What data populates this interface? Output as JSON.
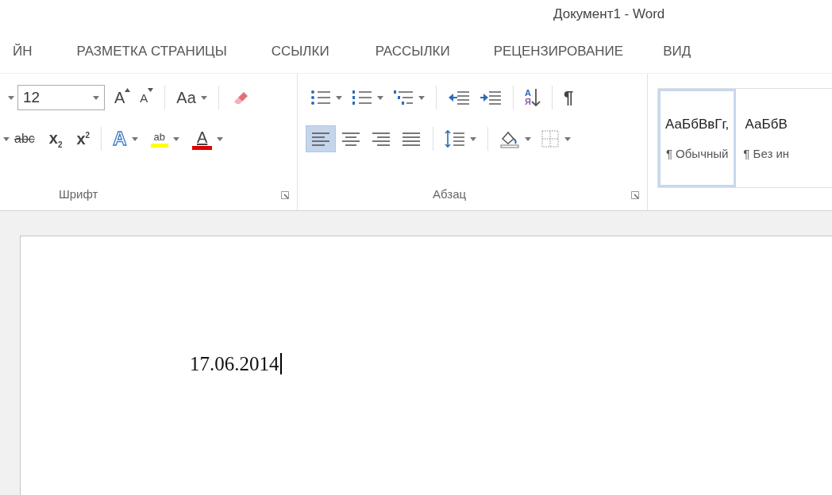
{
  "window": {
    "title": "Документ1 - Word"
  },
  "tabs": [
    {
      "label": "ЙН",
      "selected": false
    },
    {
      "label": "РАЗМЕТКА СТРАНИЦЫ",
      "selected": false
    },
    {
      "label": "ССЫЛКИ",
      "selected": false
    },
    {
      "label": "РАССЫЛКИ",
      "selected": false
    },
    {
      "label": "РЕЦЕНЗИРОВАНИЕ",
      "selected": false
    },
    {
      "label": "ВИД",
      "selected": false
    }
  ],
  "font_group": {
    "font_size": "12",
    "grow_font": "A",
    "shrink_font": "A",
    "change_case": "Aa",
    "strikethrough": "abc",
    "subscript": "x$_{2}$",
    "superscript": "x$^{2}$",
    "text_effects": "A",
    "highlight": "ab",
    "font_color": "A",
    "label": "Шрифт"
  },
  "paragraph_group": {
    "sort_letters": [
      "А",
      "Я"
    ],
    "show_marks": "¶",
    "alignment": [
      {
        "selected": true
      },
      {
        "selected": false
      },
      {
        "selected": false
      },
      {
        "selected": false
      }
    ],
    "label": "Абзац"
  },
  "styles": [
    {
      "preview": "АаБбВвГг,",
      "name": "¶ Обычный",
      "selected": true
    },
    {
      "preview": "АаБбВ",
      "name": "¶ Без ин",
      "selected": false
    }
  ],
  "document": {
    "text": "17.06.2014"
  }
}
